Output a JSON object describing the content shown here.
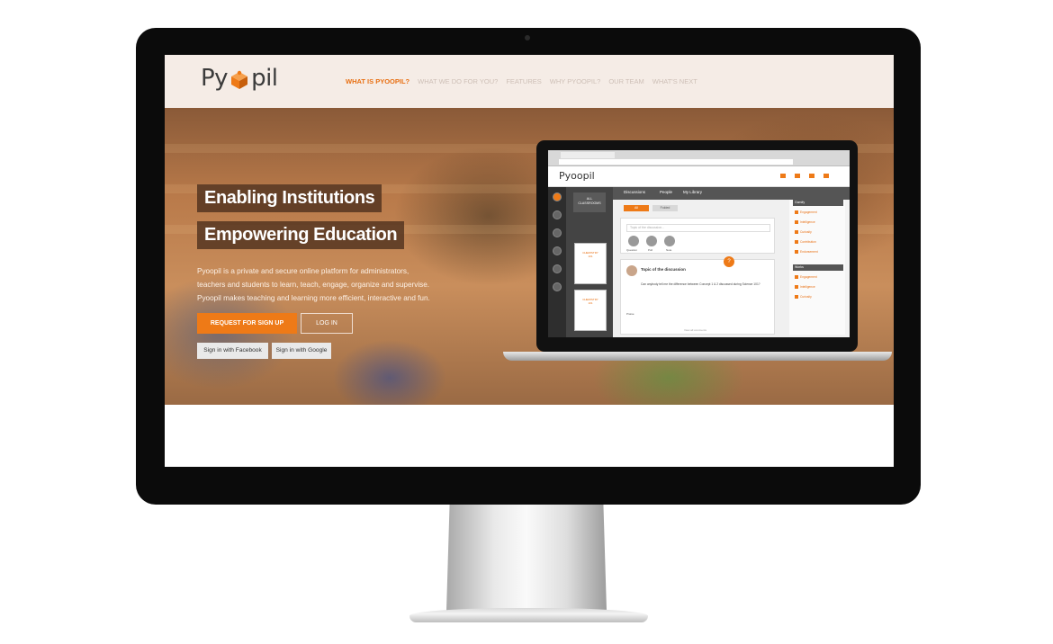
{
  "site": {
    "logo_text_1": "Py",
    "logo_text_2": "pil",
    "nav": [
      {
        "label": "WHAT IS PYOOPIL?",
        "active": true
      },
      {
        "label": "WHAT WE DO FOR YOU?",
        "active": false
      },
      {
        "label": "FEATURES",
        "active": false
      },
      {
        "label": "WHY PYOOPIL?",
        "active": false
      },
      {
        "label": "OUR TEAM",
        "active": false
      },
      {
        "label": "WHAT'S NEXT",
        "active": false
      }
    ],
    "accent_color": "#ee7a17"
  },
  "hero": {
    "tagline_1": "Enabling Institutions",
    "tagline_2": "Empowering Education",
    "intro_line_1": "Pyoopil is a private and secure online platform for administrators,",
    "intro_line_2": "teachers and students to learn, teach, engage, organize and supervise.",
    "intro_line_3": "Pyoopil makes teaching and learning more efficient, interactive and fun.",
    "signup_label": "REQUEST FOR SIGN UP",
    "login_label": "LOG IN",
    "facebook_label": "Sign in with Facebook",
    "google_label": "Sign in with Google"
  },
  "laptop_app": {
    "logo": "Pyoopil",
    "tabs": [
      "Discussions",
      "People",
      "My Library"
    ],
    "filters": [
      "All",
      "Folded"
    ],
    "classrooms_label_1": "ALL",
    "classrooms_label_2": "CLASSROOMS",
    "class_card_title_1": "CHEMISTRY",
    "class_card_code_1": "101",
    "class_card_title_2": "CHEMISTRY",
    "class_card_code_2": "101",
    "post_placeholder": "Topic of the discussion...",
    "post_types": [
      "Question",
      "Poll",
      "Note"
    ],
    "discussion_title": "Topic of the discussion",
    "discussion_body": "Can anybody tell me the difference between Concept 1 & 2 discussed during Science 101?",
    "praise_label": "Praise",
    "view_all": "View all comments",
    "right_heading_1": "Gamify",
    "right_items_1": [
      "Engagement",
      "Intelligence",
      "Curiosity",
      "Contribution",
      "Endorsement"
    ],
    "right_heading_2": "Works",
    "right_items_2": [
      "Engagement",
      "Intelligence",
      "Curiosity"
    ]
  }
}
